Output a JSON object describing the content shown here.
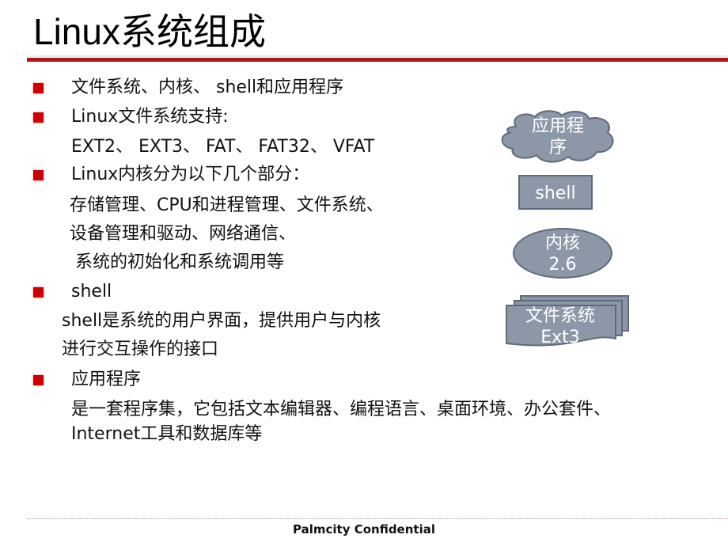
{
  "slide": {
    "title": "Linux系统组成",
    "bullets": [
      {
        "text": "文件系统、内核、 shell和应用程序"
      },
      {
        "text": "Linux文件系统支持:",
        "sub": [
          "EXT2、 EXT3、 FAT、 FAT32、 VFAT"
        ]
      },
      {
        "text": "Linux内核分为以下几个部分：",
        "sub": [
          "存储管理、CPU和进程管理、文件系统、",
          "设备管理和驱动、网络通信、",
          " 系统的初始化和系统调用等"
        ]
      },
      {
        "text": "shell",
        "sub": [
          "shell是系统的用户界面，提供用户与内核",
          "进行交互操作的接口"
        ]
      },
      {
        "text": "应用程序",
        "sub": [
          "是一套程序集，它包括文本编辑器、编程语言、桌面环境、办公套件、",
          "Internet工具和数据库等"
        ]
      }
    ],
    "diagram": {
      "cloud": {
        "line1": "应用程",
        "line2": "序"
      },
      "shell_box": "shell",
      "kernel": {
        "line1": "内核",
        "line2": "2.6"
      },
      "filesystem": {
        "line1": "文件系统",
        "line2": "Ext3"
      }
    },
    "colors": {
      "accent": "#b31515",
      "bullet": "#cc0000",
      "shape_fill": "#8c98a8",
      "shape_border": "#5f6b7a"
    },
    "footer": "Palmcity Confidential"
  }
}
